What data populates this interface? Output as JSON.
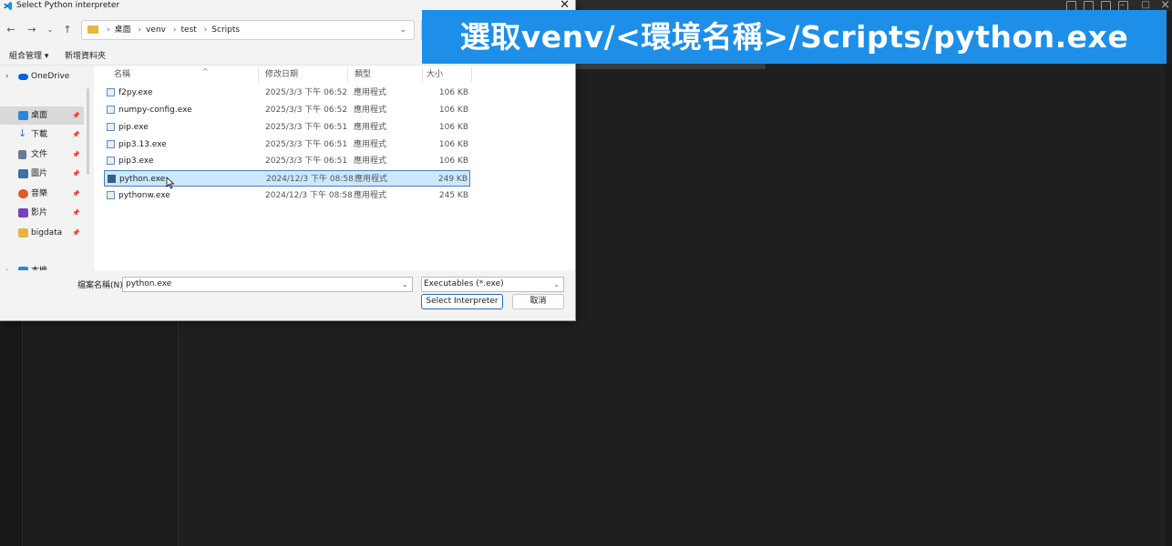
{
  "dialog": {
    "title": "Select Python interpreter",
    "address": {
      "crumbs": [
        "桌面",
        "venv",
        "test",
        "Scripts"
      ]
    },
    "toolbar": {
      "organize_label": "組合管理 ▾",
      "new_folder_label": "新增資料夾"
    },
    "nav_pane": {
      "items": [
        {
          "label": "OneDrive",
          "icon": "cloud-icon",
          "color": "#0a64d8"
        },
        {
          "label": "桌面",
          "icon": "desktop-icon",
          "color": "#2b88d8"
        },
        {
          "label": "下載",
          "icon": "download-icon",
          "color": "#1a73c9"
        },
        {
          "label": "文件",
          "icon": "document-icon",
          "color": "#6a7a99"
        },
        {
          "label": "圖片",
          "icon": "picture-icon",
          "color": "#3d6fa8"
        },
        {
          "label": "音樂",
          "icon": "music-icon",
          "color": "#e05a2b"
        },
        {
          "label": "影片",
          "icon": "video-icon",
          "color": "#7a3fb8"
        },
        {
          "label": "bigdata",
          "icon": "folder-icon",
          "color": "#e9b53f"
        },
        {
          "label": "本機",
          "icon": "computer-icon",
          "color": "#2b88d8"
        }
      ]
    },
    "columns": {
      "name": "名稱",
      "date": "修改日期",
      "type": "類型",
      "size": "大小"
    },
    "files": [
      {
        "name": "f2py.exe",
        "date": "2025/3/3 下午 06:52",
        "type": "應用程式",
        "size": "106 KB"
      },
      {
        "name": "numpy-config.exe",
        "date": "2025/3/3 下午 06:52",
        "type": "應用程式",
        "size": "106 KB"
      },
      {
        "name": "pip.exe",
        "date": "2025/3/3 下午 06:51",
        "type": "應用程式",
        "size": "106 KB"
      },
      {
        "name": "pip3.13.exe",
        "date": "2025/3/3 下午 06:51",
        "type": "應用程式",
        "size": "106 KB"
      },
      {
        "name": "pip3.exe",
        "date": "2025/3/3 下午 06:51",
        "type": "應用程式",
        "size": "106 KB"
      },
      {
        "name": "python.exe",
        "date": "2024/12/3 下午 08:58",
        "type": "應用程式",
        "size": "249 KB"
      },
      {
        "name": "pythonw.exe",
        "date": "2024/12/3 下午 08:58",
        "type": "應用程式",
        "size": "245 KB"
      }
    ],
    "filename": {
      "label": "檔案名稱(N):",
      "value": "python.exe"
    },
    "filetype": {
      "value": "Executables (*.exe)"
    },
    "buttons": {
      "select_label": "Select Interpreter",
      "cancel_label": "取消"
    }
  },
  "caption": "選取venv/<環境名稱>/Scripts/python.exe",
  "colors": {
    "caption_bg": "#1d8fe8",
    "selection": "#cce8ff",
    "editor_bg": "#1f1f1f"
  }
}
